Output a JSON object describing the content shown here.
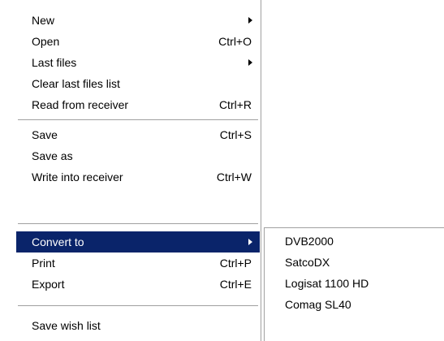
{
  "menu": {
    "new": {
      "label": "New",
      "shortcut": ""
    },
    "open": {
      "label": "Open",
      "shortcut": "Ctrl+O"
    },
    "last_files": {
      "label": "Last files",
      "shortcut": ""
    },
    "clear_last_files": {
      "label": "Clear last files list",
      "shortcut": ""
    },
    "read_from_receiver": {
      "label": "Read from receiver",
      "shortcut": "Ctrl+R"
    },
    "save": {
      "label": "Save",
      "shortcut": "Ctrl+S"
    },
    "save_as": {
      "label": "Save as",
      "shortcut": ""
    },
    "write_into_receiver": {
      "label": "Write into receiver",
      "shortcut": "Ctrl+W"
    },
    "convert_to": {
      "label": "Convert to",
      "shortcut": ""
    },
    "print": {
      "label": "Print",
      "shortcut": "Ctrl+P"
    },
    "export": {
      "label": "Export",
      "shortcut": "Ctrl+E"
    },
    "save_wish_list": {
      "label": "Save wish list",
      "shortcut": ""
    }
  },
  "submenu": {
    "items": [
      {
        "label": "DVB2000"
      },
      {
        "label": "SatcoDX"
      },
      {
        "label": "Logisat 1100 HD"
      },
      {
        "label": "Comag SL40"
      }
    ]
  },
  "colors": {
    "highlight": "#0a246a",
    "highlight_text": "#ffffff",
    "separator": "#a0a0a0"
  },
  "icons": {
    "submenu_arrow": "chevron-right-icon"
  }
}
